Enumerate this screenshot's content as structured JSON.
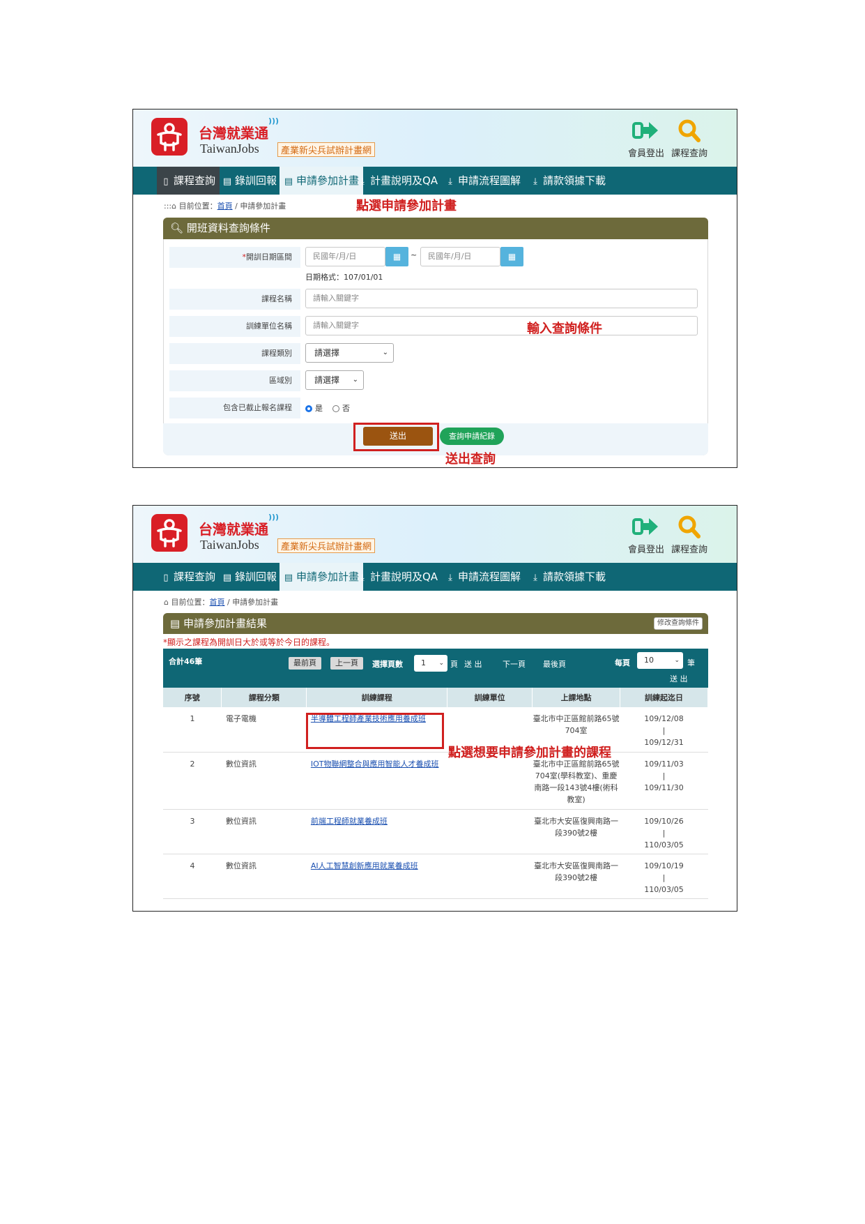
{
  "header": {
    "brand_cn": "台灣就業通",
    "brand_en": "TaiwanJobs",
    "brand_tag": "產業新尖兵試辦計畫網",
    "logout_label": "會員登出",
    "course_search_label": "課程查詢"
  },
  "nav": {
    "items": [
      "課程查詢",
      "錄訓回報",
      "申請參加計畫",
      "計畫說明及QA",
      "申請流程圖解",
      "請款領據下載"
    ]
  },
  "breadcrumb": {
    "prefix": "目前位置：",
    "home": "首頁",
    "sep": " / ",
    "current": "申請參加計畫"
  },
  "shot1": {
    "annot_nav": "點選申請參加計畫",
    "annot_input": "輸入查詢條件",
    "annot_submit": "送出查詢",
    "panel_title": "開班資料查詢條件",
    "date_label": "開訓日期區間",
    "date_placeholder": "民國年/月/日",
    "date_sep": "~",
    "date_hint": "日期格式：107/01/01",
    "course_label": "課程名稱",
    "course_placeholder": "請輸入關鍵字",
    "unit_label": "訓練單位名稱",
    "unit_placeholder": "請輸入關鍵字",
    "category_label": "課程類別",
    "category_value": "請選擇",
    "region_label": "區域別",
    "region_value": "請選擇",
    "include_label": "包含已截止報名課程",
    "opt_yes": "是",
    "opt_no": "否",
    "submit": "送出",
    "history": "查詢申請紀錄"
  },
  "shot2": {
    "panel_title": "申請參加計畫結果",
    "modify_btn": "修改查詢條件",
    "note": "*顯示之課程為開訓日大於或等於今日的課程。",
    "total": "合計46筆",
    "first": "最前頁",
    "prev": "上一頁",
    "choose_page": "選擇頁數",
    "page_value": "1",
    "page_unit": "頁",
    "go": "送 出",
    "next": "下一頁",
    "last": "最後頁",
    "per_page": "每頁",
    "per_page_value": "10",
    "per_page_unit": "筆",
    "go2": "送 出",
    "annot_row": "點選想要申請參加計畫的課程",
    "columns": [
      "序號",
      "課程分類",
      "訓練課程",
      "訓練單位",
      "上課地點",
      "訓練起迄日"
    ],
    "rows": [
      {
        "no": "1",
        "cat": "電子電機",
        "course": "半導體工程師產業技術應用養成班",
        "unit": "",
        "place": "臺北市中正區館前路65號704室",
        "start": "109/12/08",
        "bar": "|",
        "end": "109/12/31"
      },
      {
        "no": "2",
        "cat": "數位資訊",
        "course": "IOT物聯網整合與應用智能人才養成班",
        "unit": "",
        "place": "臺北市中正區館前路65號704室(學科教室)、重慶南路一段143號4樓(術科教室)",
        "start": "109/11/03",
        "bar": "|",
        "end": "109/11/30"
      },
      {
        "no": "3",
        "cat": "數位資訊",
        "course": "前端工程師就業養成班",
        "unit": "",
        "place": "臺北市大安區復興南路一段390號2樓",
        "start": "109/10/26",
        "bar": "|",
        "end": "110/03/05"
      },
      {
        "no": "4",
        "cat": "數位資訊",
        "course": "AI人工智慧創新應用就業養成班",
        "unit": "",
        "place": "臺北市大安區復興南路一段390號2樓",
        "start": "109/10/19",
        "bar": "|",
        "end": "110/03/05"
      }
    ]
  }
}
